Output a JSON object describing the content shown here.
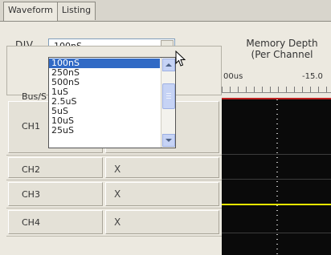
{
  "tabs": [
    {
      "label": "Waveform",
      "active": true
    },
    {
      "label": "Listing",
      "active": false
    }
  ],
  "div": {
    "label": "DIV",
    "selected": "100nS",
    "options": [
      "100nS",
      "250nS",
      "500nS",
      "1uS",
      "2.5uS",
      "5uS",
      "10uS",
      "25uS"
    ]
  },
  "memory": {
    "line1": "Memory Depth",
    "line2": "(Per Channel"
  },
  "bus_label": "Bus/S",
  "ruler": {
    "tick0": "00us",
    "tick1": "-15.0"
  },
  "channels": [
    {
      "name": "CH1",
      "value": ""
    },
    {
      "name": "CH2",
      "value": "X"
    },
    {
      "name": "CH3",
      "value": "X"
    },
    {
      "name": "CH4",
      "value": "X"
    }
  ],
  "colors": {
    "selection": "#316ac5",
    "wave_bg": "#0a0a0a",
    "trace_yellow": "#e6e600",
    "trace_red": "#c02020"
  },
  "icons": {
    "cursor": "arrow-pointer-icon",
    "dropdown": "chevron-down-icon"
  }
}
